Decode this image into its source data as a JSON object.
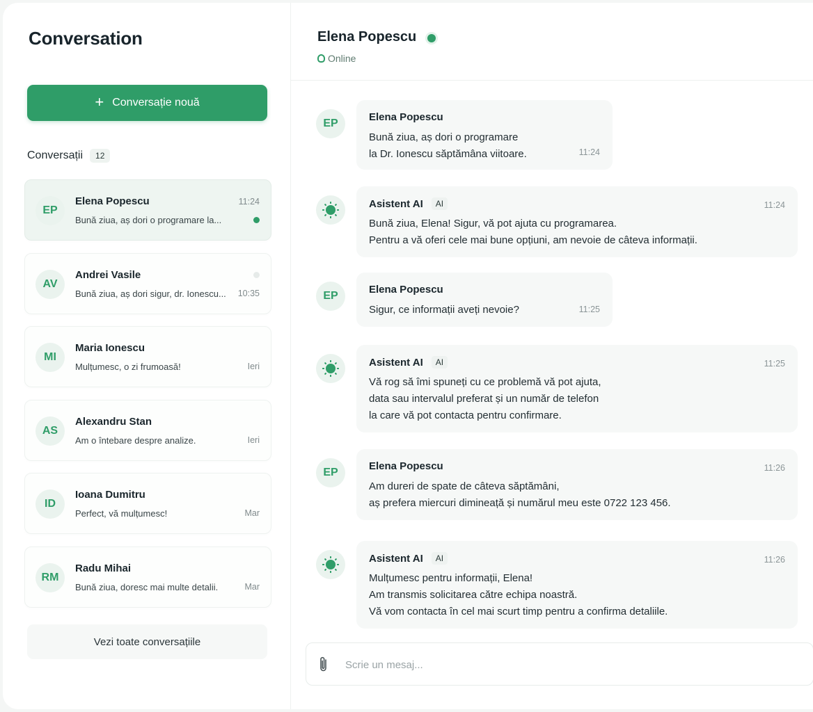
{
  "sidebar": {
    "title": "Conversation",
    "new_button": "Conversație nouă",
    "list_label": "Conversații",
    "list_count": "12",
    "see_all": "Vezi toate conversațiile",
    "items": [
      {
        "initials": "EP",
        "name": "Elena Popescu",
        "preview": "Bună ziua, aș dori o programare la...",
        "time": "11:24",
        "dot": "#2f9d68",
        "active": true
      },
      {
        "initials": "AV",
        "name": "Andrei Vasile",
        "preview": "Bună ziua, aș dori sigur, dr. Ionescu...",
        "time": "10:35",
        "dot": "#e6ebe9",
        "active": false
      },
      {
        "initials": "MI",
        "name": "Maria Ionescu",
        "preview": "Mulțumesc, o zi frumoasă!",
        "time": "Ieri",
        "dot": "",
        "active": false
      },
      {
        "initials": "AS",
        "name": "Alexandru Stan",
        "preview": "Am o întebare despre analize.",
        "time": "Ieri",
        "dot": "",
        "active": false
      },
      {
        "initials": "ID",
        "name": "Ioana Dumitru",
        "preview": "Perfect, vă mulțumesc!",
        "time": "Mar",
        "dot": "",
        "active": false
      },
      {
        "initials": "RM",
        "name": "Radu Mihai",
        "preview": "Bună ziua, doresc mai multe detalii.",
        "time": "Mar",
        "dot": "",
        "active": false
      }
    ]
  },
  "chat": {
    "contact_name": "Elena Popescu",
    "status": "Online",
    "messages": [
      {
        "sender": "Elena Popescu",
        "initials": "EP",
        "ai": false,
        "time": "11:24",
        "lines": [
          "Bună ziua, aș dori o programare",
          "la Dr. Ionescu săptămâna viitoare."
        ]
      },
      {
        "sender": "Asistent AI",
        "initials": "",
        "ai": true,
        "ai_label": "AI",
        "time": "11:24",
        "lines": [
          "Bună ziua, Elena! Sigur, vă pot ajuta cu programarea.",
          "Pentru a vă oferi cele mai bune opțiuni, am nevoie de câteva informații."
        ]
      },
      {
        "sender": "Elena Popescu",
        "initials": "EP",
        "ai": false,
        "time": "11:25",
        "lines": [
          "Sigur, ce informații aveți nevoie?"
        ]
      },
      {
        "sender": "Asistent AI",
        "initials": "",
        "ai": true,
        "ai_label": "AI",
        "time": "11:25",
        "lines": [
          "Vă rog să îmi spuneți cu ce problemă vă pot ajuta,",
          "data sau intervalul preferat și un număr de telefon",
          "la care vă pot contacta pentru confirmare."
        ]
      },
      {
        "sender": "Elena Popescu",
        "initials": "EP",
        "ai": false,
        "time": "11:26",
        "lines": [
          "Am dureri de spate de câteva săptămâni,",
          "aș prefera miercuri dimineață și numărul meu este 0722 123 456."
        ]
      },
      {
        "sender": "Asistent AI",
        "initials": "",
        "ai": true,
        "ai_label": "AI",
        "time": "11:26",
        "lines": [
          "Mulțumesc pentru informații, Elena!",
          "Am transmis solicitarea către echipa noastră.",
          "Vă vom contacta în cel mai scurt timp pentru a confirma detaliile."
        ]
      }
    ],
    "composer_placeholder": "Scrie un mesaj..."
  },
  "icons": {
    "new": "plus-icon",
    "status": "online-status-icon",
    "ai_avatar": "sun-icon",
    "attach": "paperclip-icon"
  },
  "colors": {
    "accent": "#2f9d68",
    "avatar_bg": "#eaf3ee",
    "bubble_bg": "#f6f8f7"
  }
}
